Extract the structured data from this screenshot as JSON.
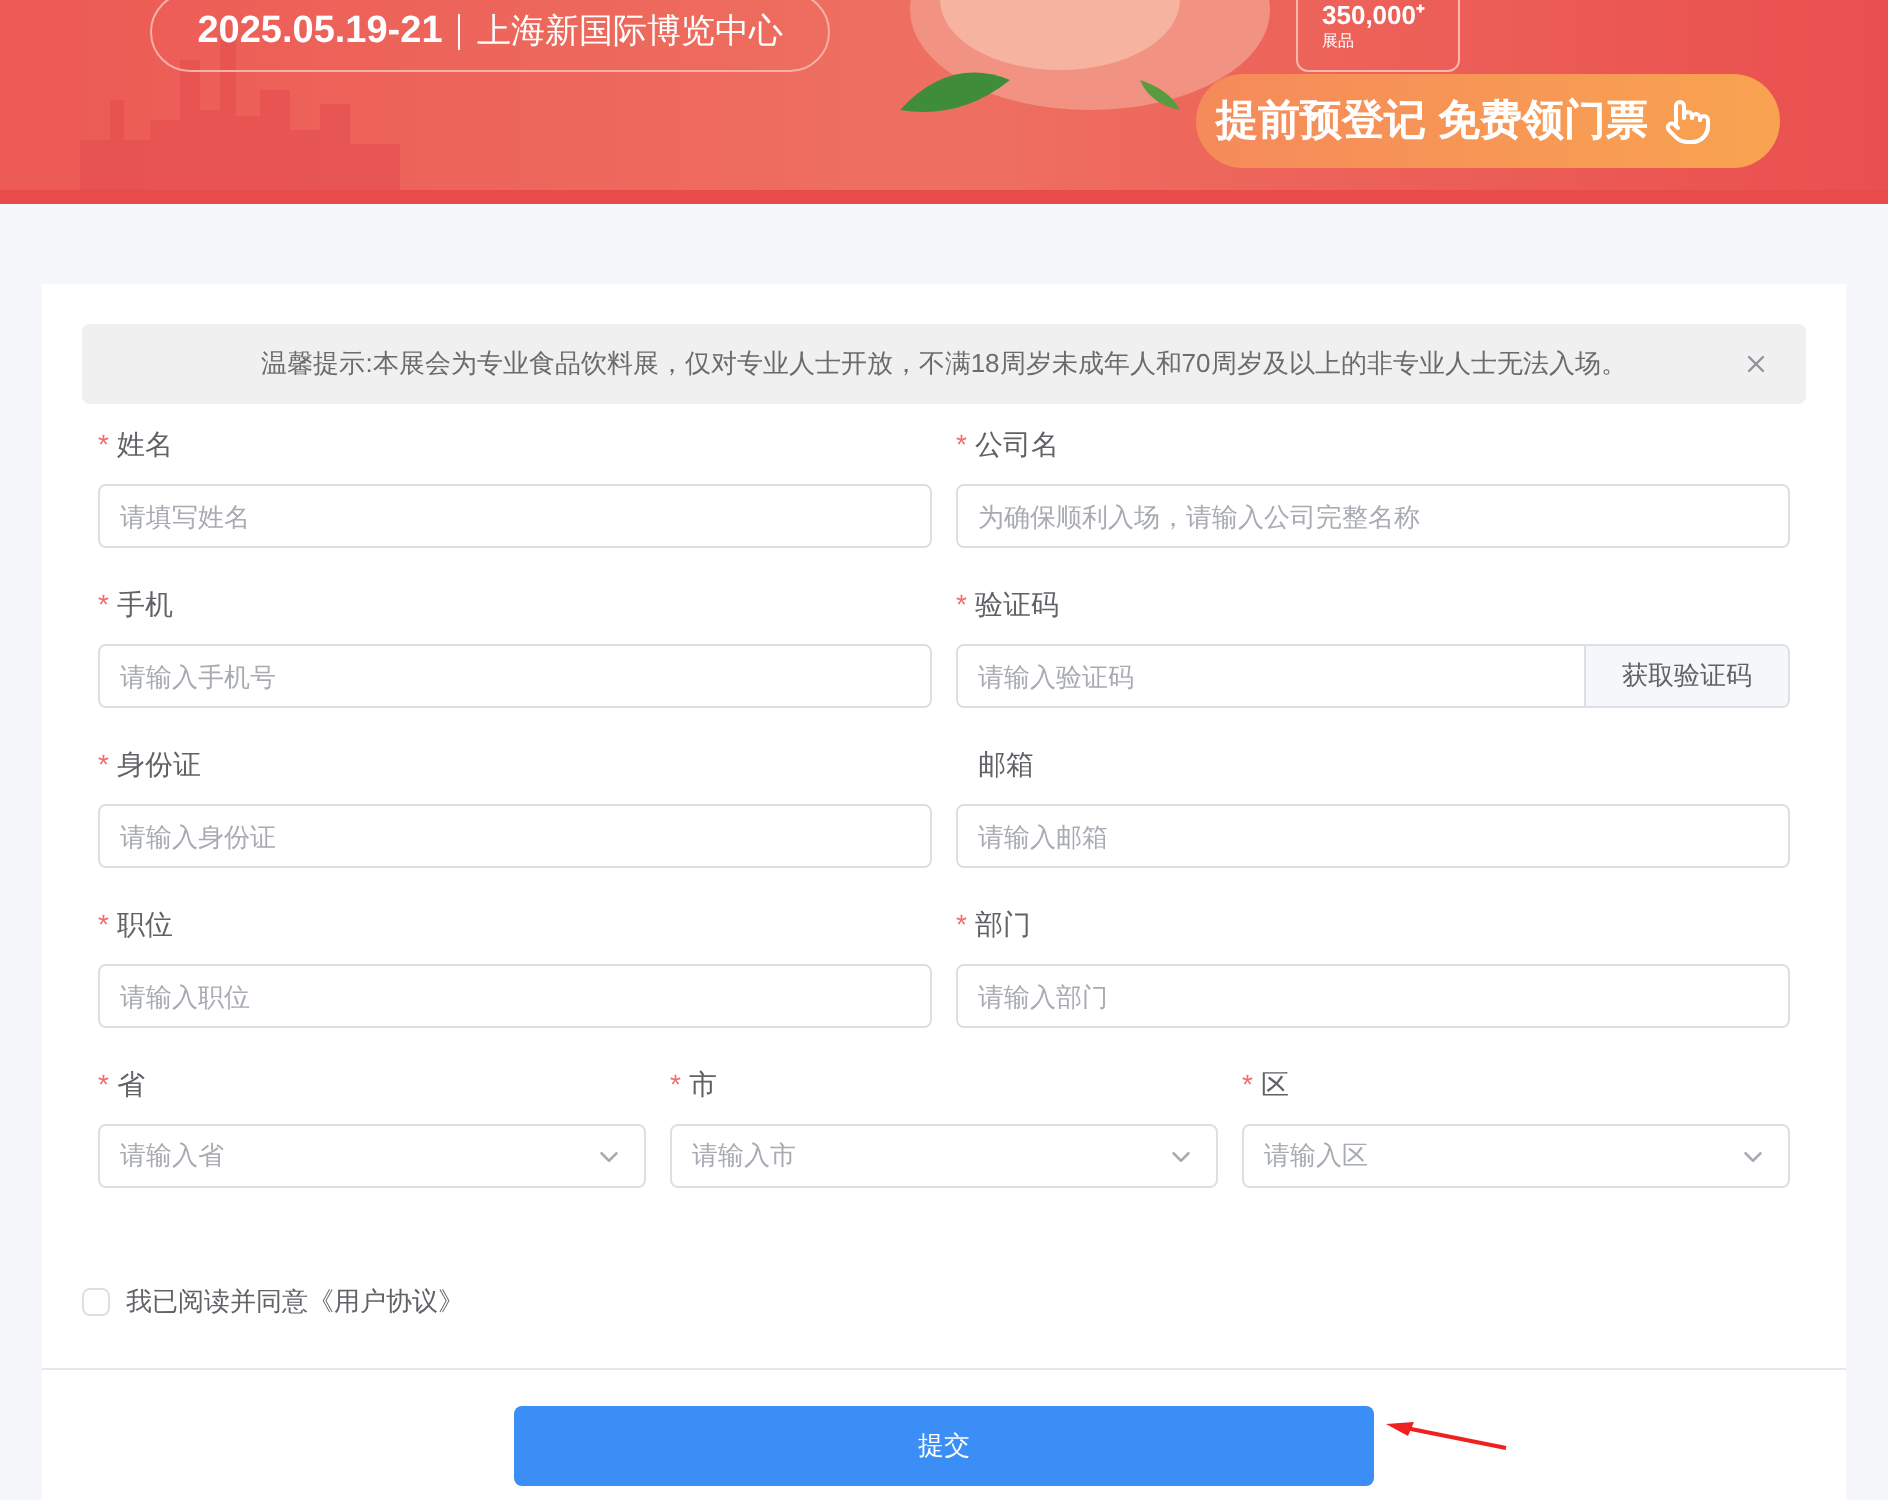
{
  "banner": {
    "date": "2025.05.19-21",
    "venue": "上海新国际博览中心",
    "stat": "350,000⁺",
    "stat_label": "展品",
    "cta": "提前预登记 免费领门票"
  },
  "notice": {
    "text": "温馨提示:本展会为专业食品饮料展，仅对专业人士开放，不满18周岁未成年人和70周岁及以上的非专业人士无法入场。",
    "closable": true
  },
  "rows": [
    [
      {
        "label": "姓名",
        "required": true,
        "placeholder": "请填写姓名",
        "kind": "text"
      },
      {
        "label": "公司名",
        "required": true,
        "placeholder": "为确保顺利入场，请输入公司完整名称",
        "kind": "text"
      }
    ],
    [
      {
        "label": "手机",
        "required": true,
        "placeholder": "请输入手机号",
        "kind": "text"
      },
      {
        "label": "验证码",
        "required": true,
        "placeholder": "请输入验证码",
        "kind": "code",
        "button": "获取验证码"
      }
    ],
    [
      {
        "label": "身份证",
        "required": true,
        "placeholder": "请输入身份证",
        "kind": "text"
      },
      {
        "label": "邮箱",
        "required": false,
        "placeholder": "请输入邮箱",
        "kind": "text"
      }
    ],
    [
      {
        "label": "职位",
        "required": true,
        "placeholder": "请输入职位",
        "kind": "text"
      },
      {
        "label": "部门",
        "required": true,
        "placeholder": "请输入部门",
        "kind": "text"
      }
    ],
    [
      {
        "label": "省",
        "required": true,
        "placeholder": "请输入省",
        "kind": "select"
      },
      {
        "label": "市",
        "required": true,
        "placeholder": "请输入市",
        "kind": "select"
      },
      {
        "label": "区",
        "required": true,
        "placeholder": "请输入区",
        "kind": "select"
      }
    ]
  ],
  "agreement": {
    "label": "我已阅读并同意《用户协议》",
    "checked": false
  },
  "submit": "提交",
  "required_mark": "*"
}
